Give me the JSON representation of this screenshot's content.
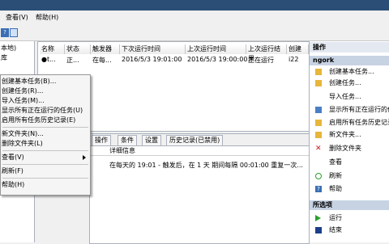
{
  "menubar": {
    "items": [
      "查看(V)",
      "帮助(H)"
    ]
  },
  "toolbar": {
    "help_icon": "?"
  },
  "tree": {
    "items": [
      "本地)",
      "库"
    ]
  },
  "grid": {
    "columns": [
      "名称",
      "状态",
      "触发器",
      "下次运行时间",
      "上次运行时间",
      "上次运行结果",
      "创建"
    ],
    "row": [
      "●t...",
      "正...",
      "在每...",
      "2016/5/3 19:01:00",
      "2016/5/3 19:00:00",
      "正在运行",
      "i22"
    ]
  },
  "detail": {
    "tabs": [
      "操作",
      "条件",
      "设置",
      "历史记录(已禁用)"
    ],
    "header": "详细信息",
    "text": "在每天的 19:01 - 触发后，在 1 天 期间每隔 00:01:00 重复一次..."
  },
  "context_menu": {
    "items": [
      "创建基本任务(B)...",
      "创建任务(R)...",
      "导入任务(M)...",
      "显示所有正在运行的任务(U)",
      "启用所有任务历史记录(E)",
      "新文件夹(N)...",
      "删除文件夹(L)",
      "查看(V)",
      "刷新(F)",
      "帮助(H)"
    ]
  },
  "actions": {
    "title": "操作",
    "section1": "ngork",
    "items": [
      "创建基本任务...",
      "创建任务...",
      "导入任务...",
      "显示所有正在运行的任务",
      "启用所有任务历史记录",
      "新文件夹...",
      "删除文件夹",
      "查看",
      "刷新",
      "帮助"
    ],
    "section2": "所选项",
    "items2": [
      "运行",
      "结束"
    ]
  },
  "colors": {
    "titlebar": "#2b4e76",
    "accent": "#3a6fb4"
  }
}
